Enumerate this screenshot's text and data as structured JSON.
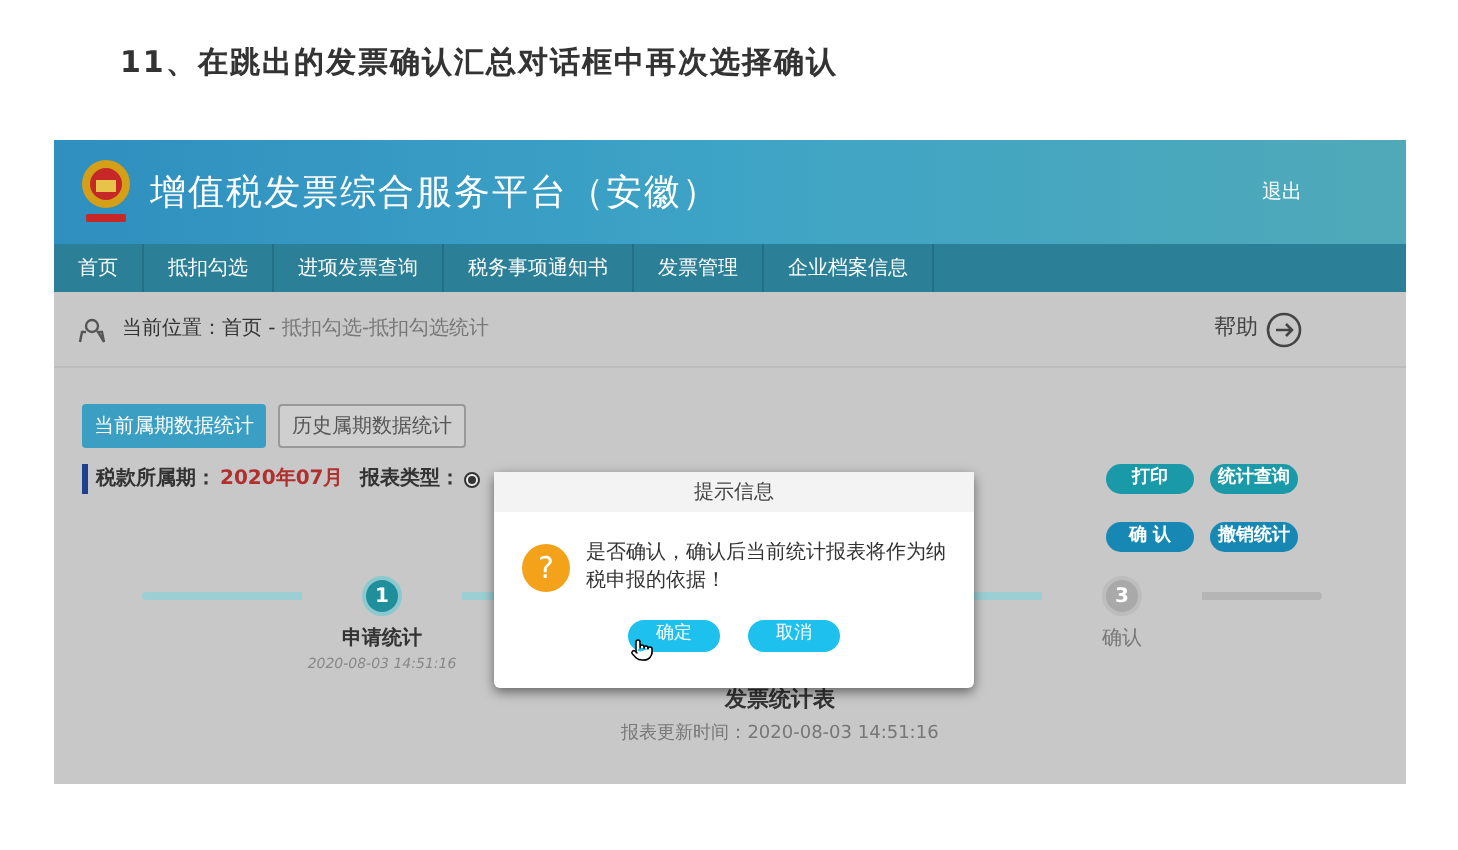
{
  "heading": "11、在跳出的发票确认汇总对话框中再次选择确认",
  "app": {
    "title": "增值税发票综合服务平台（安徽）",
    "logout": "退出",
    "nav": [
      "首页",
      "抵扣勾选",
      "进项发票查询",
      "税务事项通知书",
      "发票管理",
      "企业档案信息"
    ],
    "breadcrumb": {
      "label": "当前位置：首页 -",
      "path": "抵扣勾选-抵扣勾选统计"
    },
    "help": "帮助",
    "tabs": [
      {
        "label": "当前属期数据统计",
        "selected": true
      },
      {
        "label": "历史属期数据统计",
        "selected": false
      }
    ],
    "period_label": "税款所属期：",
    "period": "2020年07月",
    "report_type_label": "报表类型：",
    "report_type_radio": {
      "selected": true
    },
    "actions": [
      "打印",
      "统计查询"
    ],
    "confirm_actions": [
      "确 认",
      "撤销统计"
    ],
    "steps": [
      {
        "number": "1",
        "label": "申请统计",
        "time": "2020-08-03 14:51:16",
        "done": true
      },
      {
        "number": "3",
        "label": "确认",
        "done": false
      }
    ],
    "report_title": "发票统计表",
    "report_time": "报表更新时间：2020-08-03 14:51:16",
    "dialog": {
      "title": "提示信息",
      "icon": "?",
      "message": "是否确认，确认后当前统计报表将作为纳税申报的依据！",
      "buttons": [
        "确定",
        "取消"
      ]
    }
  }
}
